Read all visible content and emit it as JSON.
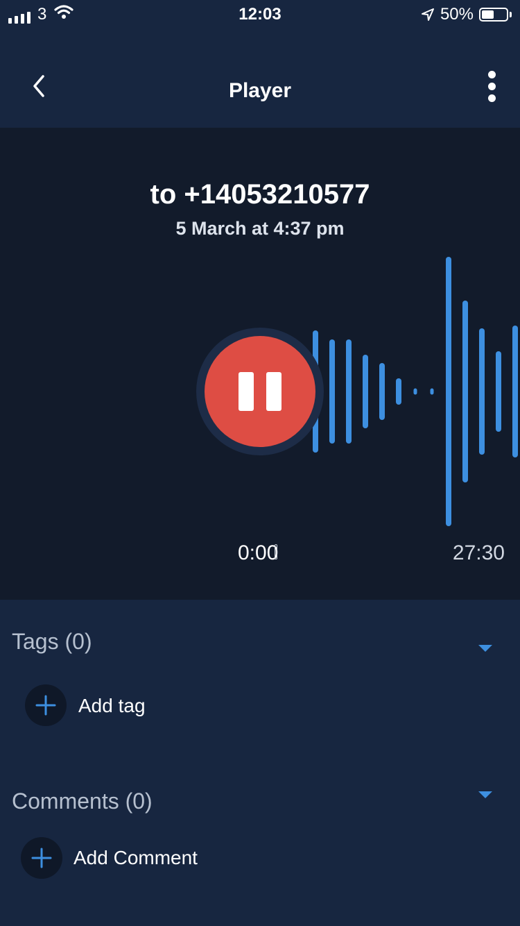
{
  "status_bar": {
    "carrier": "3",
    "time": "12:03",
    "battery": "50%",
    "battery_level": 0.5
  },
  "nav": {
    "title": "Player",
    "back_icon": "chevron-left-icon",
    "more_icon": "more-vertical-icon"
  },
  "call": {
    "target": "to +14053210577",
    "date": "5 March at 4:37 pm"
  },
  "player": {
    "state": "playing",
    "control_icon": "pause-icon",
    "elapsed": "0:00",
    "duration": "27:30",
    "progress": 0
  },
  "tags": {
    "title": "Tags (0)",
    "add_label": "Add tag"
  },
  "comments": {
    "title": "Comments (0)",
    "add_label": "Add Comment"
  },
  "colors": {
    "background": "#172640",
    "player_background": "#121b2b",
    "accent_blue": "#3d8fe0",
    "play_button": "#de4d44"
  }
}
